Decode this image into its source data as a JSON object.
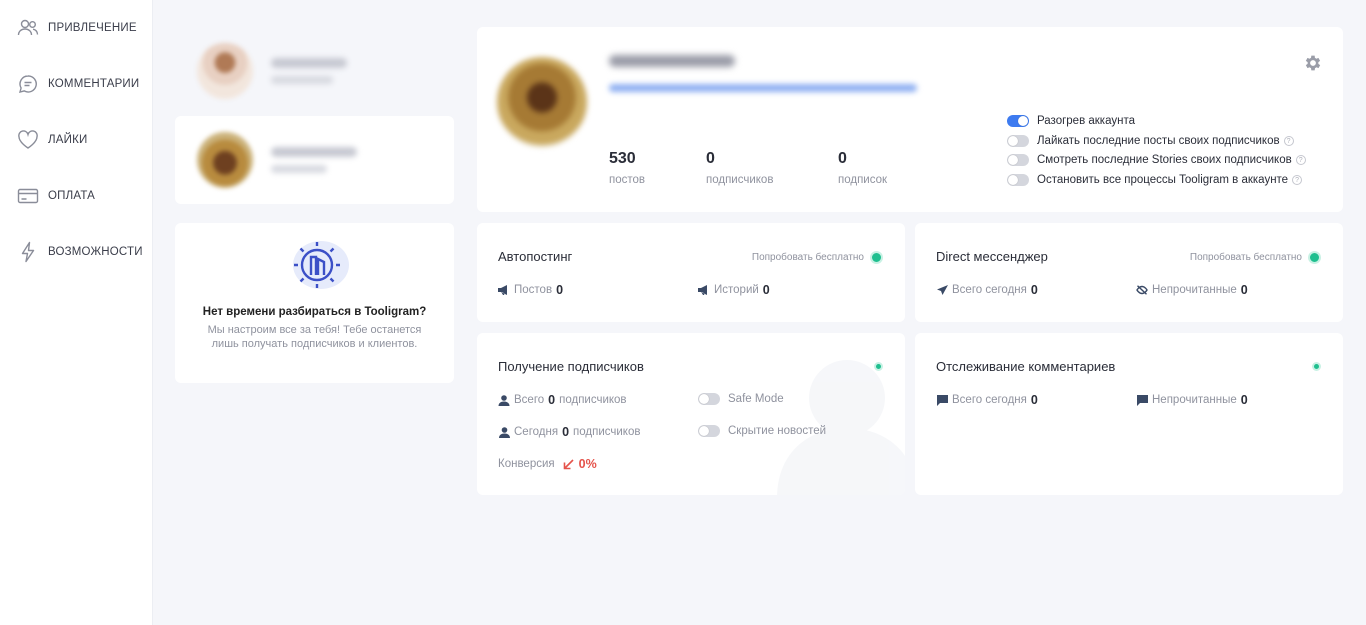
{
  "sidebar": {
    "items": [
      {
        "label": "ПРИВЛЕЧЕНИЕ",
        "icon": "users-icon"
      },
      {
        "label": "КОММЕНТАРИИ",
        "icon": "comment-icon"
      },
      {
        "label": "ЛАЙКИ",
        "icon": "heart-icon"
      },
      {
        "label": "ОПЛАТА",
        "icon": "credit-card-icon"
      },
      {
        "label": "ВОЗМОЖНОСТИ",
        "icon": "lightning-icon"
      }
    ]
  },
  "promo": {
    "title": "Нет времени разбираться в Tooligram?",
    "text": "Мы настроим все за тебя! Тебе останется лишь получать подписчиков и клиентов."
  },
  "profile": {
    "stats": [
      {
        "value": "530",
        "label": "постов"
      },
      {
        "value": "0",
        "label": "подписчиков"
      },
      {
        "value": "0",
        "label": "подписок"
      }
    ],
    "options": [
      {
        "label": "Разогрев аккаунта",
        "on": true,
        "help": false
      },
      {
        "label": "Лайкать последние посты своих подписчиков",
        "on": false,
        "help": true
      },
      {
        "label": "Смотреть последние Stories своих подписчиков",
        "on": false,
        "help": true
      },
      {
        "label": "Остановить все процессы Tooligram в аккаунте",
        "on": false,
        "help": true
      }
    ]
  },
  "autoposting": {
    "title": "Автопостинг",
    "try_label": "Попробовать бесплатно",
    "posts_label": "Постов",
    "posts_value": "0",
    "stories_label": "Историй",
    "stories_value": "0"
  },
  "direct": {
    "title": "Direct мессенджер",
    "try_label": "Попробовать бесплатно",
    "today_label": "Всего сегодня",
    "today_value": "0",
    "unread_label": "Непрочитанные",
    "unread_value": "0"
  },
  "followers": {
    "title": "Получение подписчиков",
    "total_label": "Всего",
    "total_value": "0",
    "total_tail": "подписчиков",
    "today_label": "Сегодня",
    "today_value": "0",
    "today_tail": "подписчиков",
    "conversion_label": "Конверсия",
    "conversion_value": "0%",
    "safe_mode_label": "Safe Mode",
    "hide_news_label": "Скрытие новостей"
  },
  "comments": {
    "title": "Отслеживание комментариев",
    "today_label": "Всего сегодня",
    "today_value": "0",
    "unread_label": "Непрочитанные",
    "unread_value": "0"
  },
  "colors": {
    "accent": "#3d7bf0",
    "status_green": "#1fbf8f",
    "negative": "#e5534b"
  }
}
